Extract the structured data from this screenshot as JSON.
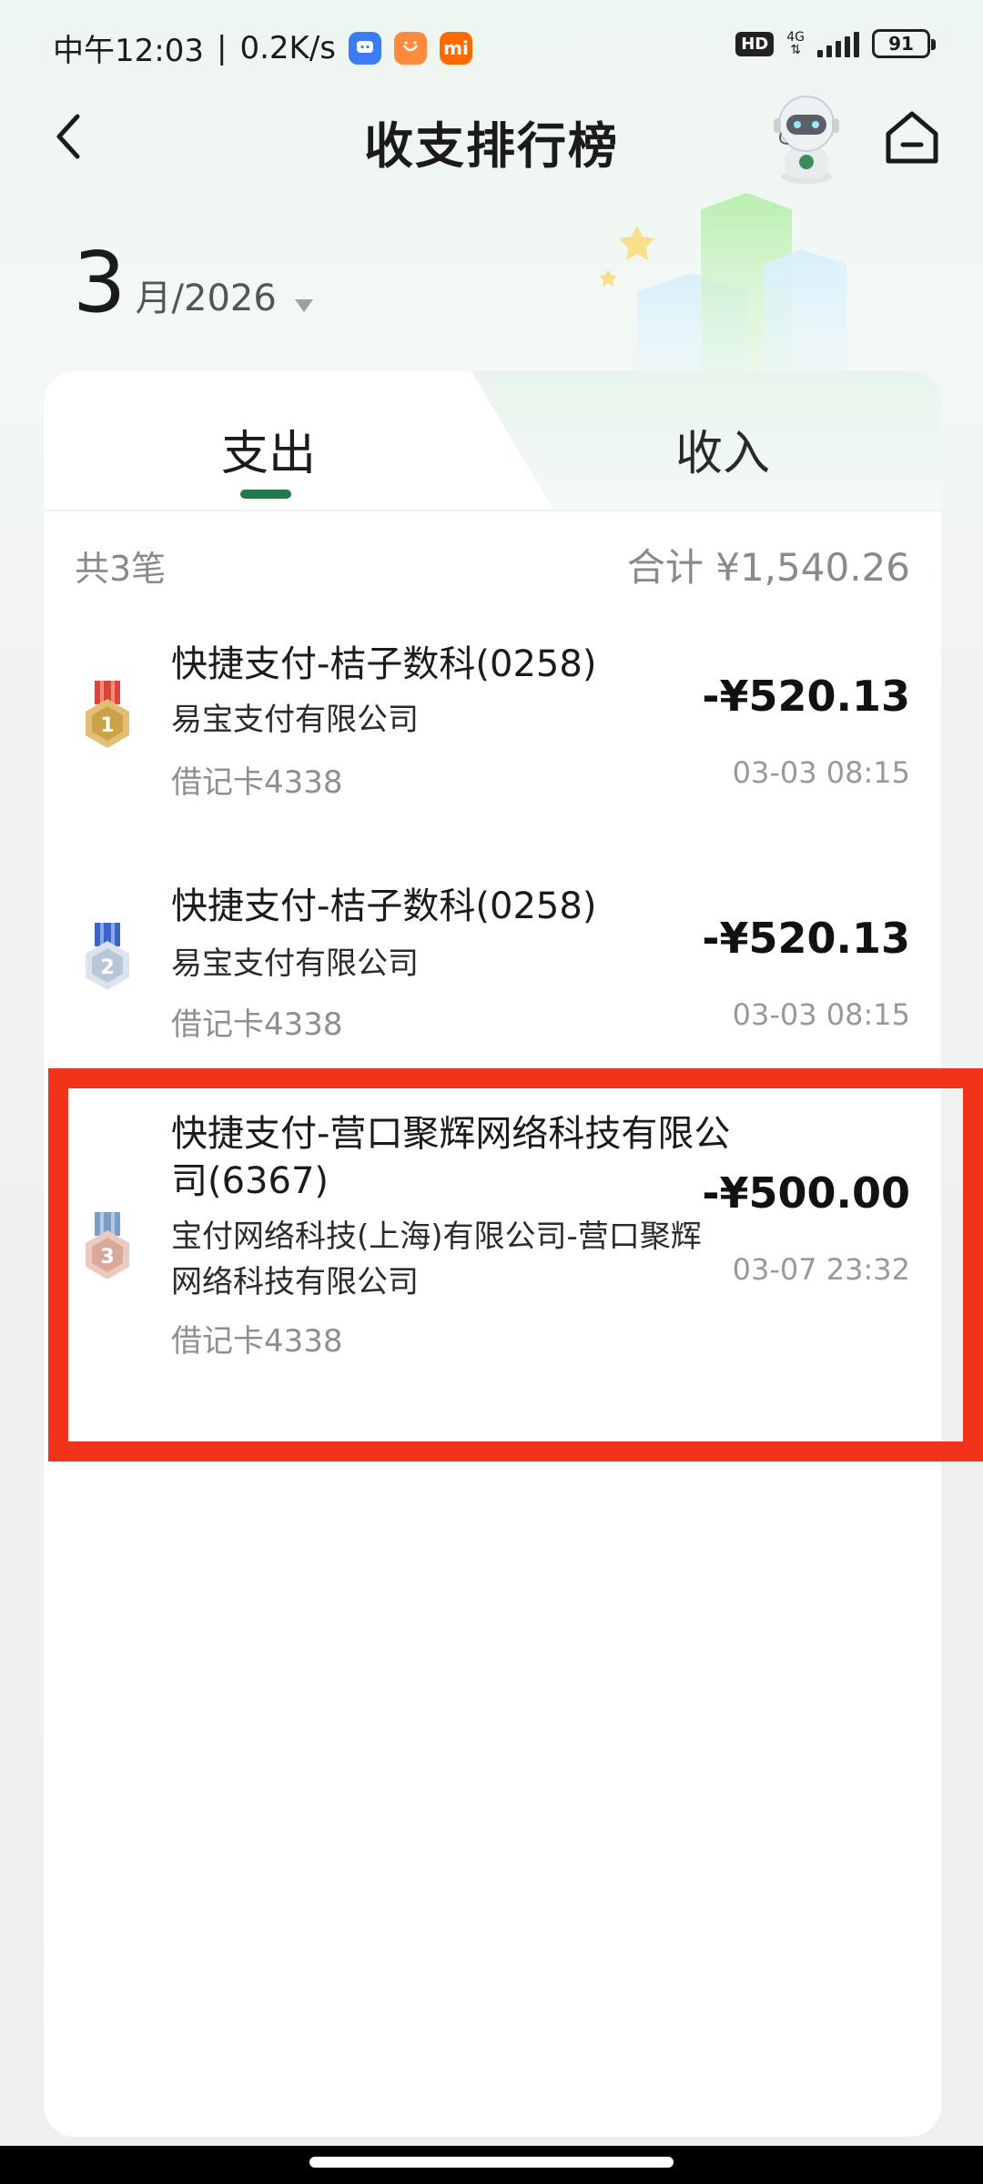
{
  "status_bar": {
    "time": "中午12:03",
    "speed": "0.2K/s",
    "hd": "HD",
    "network": "4G",
    "battery": "91",
    "app_icons": [
      "chat-app-icon",
      "taobao-icon",
      "mi-icon"
    ],
    "app_icon_colors": [
      "#3b7cf6",
      "#ff8a3d",
      "#ff6a00"
    ]
  },
  "header": {
    "title": "收支排行榜",
    "back_icon": "chevron-left-icon",
    "mascot_icon": "robot-mascot-icon",
    "home_icon": "home-icon"
  },
  "month": {
    "month_num": "3",
    "month_rest": "月/2026"
  },
  "tabs": [
    {
      "label": "支出",
      "active": true
    },
    {
      "label": "收入",
      "active": false
    }
  ],
  "summary": {
    "count": "共3笔",
    "total": "合计 ¥1,540.26"
  },
  "transactions": [
    {
      "rank": "1",
      "merchant": "快捷支付-桔子数科(0258)",
      "payee": "易宝支付有限公司",
      "card": "借记卡4338",
      "amount": "-¥520.13",
      "time": "03-03 08:15",
      "medal_color": "#c9a24a",
      "ribbon_color": "#d9453b"
    },
    {
      "rank": "2",
      "merchant": "快捷支付-桔子数科(0258)",
      "payee": "易宝支付有限公司",
      "card": "借记卡4338",
      "amount": "-¥520.13",
      "time": "03-03 08:15",
      "medal_color": "#b9c6d6",
      "ribbon_color": "#3c64c6"
    },
    {
      "rank": "3",
      "merchant": "快捷支付-营口聚辉网络科技有限公司(6367)",
      "merchant_line1": "快捷支付-营口聚辉网络科技有限公",
      "merchant_line2": "司(6367)",
      "payee_line1": "宝付网络科技(上海)有限公司-营口聚辉",
      "payee_line2": "网络科技有限公司",
      "card": "借记卡4338",
      "amount": "-¥500.00",
      "time": "03-07 23:32",
      "medal_color": "#d8a99a",
      "ribbon_color": "#7a9cc6"
    }
  ],
  "colors": {
    "accent_green": "#1f7a4d",
    "highlight_red": "#f2331b"
  }
}
